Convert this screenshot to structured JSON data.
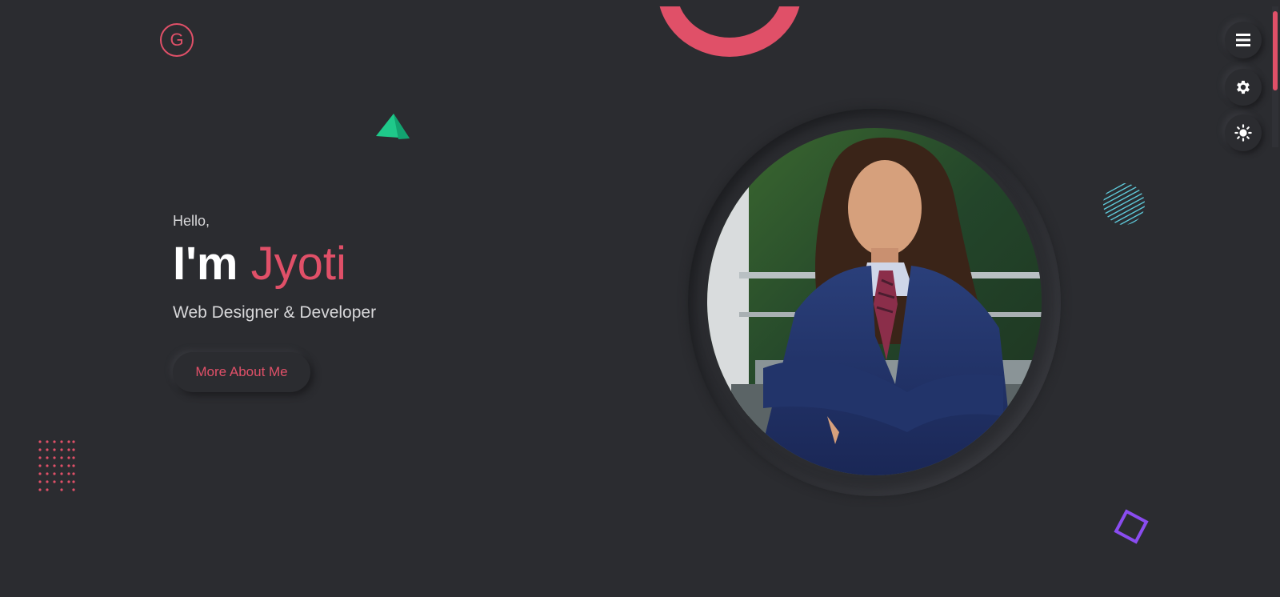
{
  "logo": {
    "letter": "G"
  },
  "hero": {
    "greeting": "Hello,",
    "headline_prefix": "I'm",
    "name": "Jyoti",
    "role": "Web Designer & Developer",
    "cta_label": "More About Me"
  },
  "side_nav": {
    "buttons": [
      {
        "icon": "menu-icon"
      },
      {
        "icon": "gear-icon"
      },
      {
        "icon": "sun-icon"
      }
    ]
  },
  "colors": {
    "background": "#2b2c30",
    "accent": "#e05068",
    "triangle": "#1fc98a",
    "stripes": "#5ec8d8",
    "square": "#8a4cf0"
  }
}
